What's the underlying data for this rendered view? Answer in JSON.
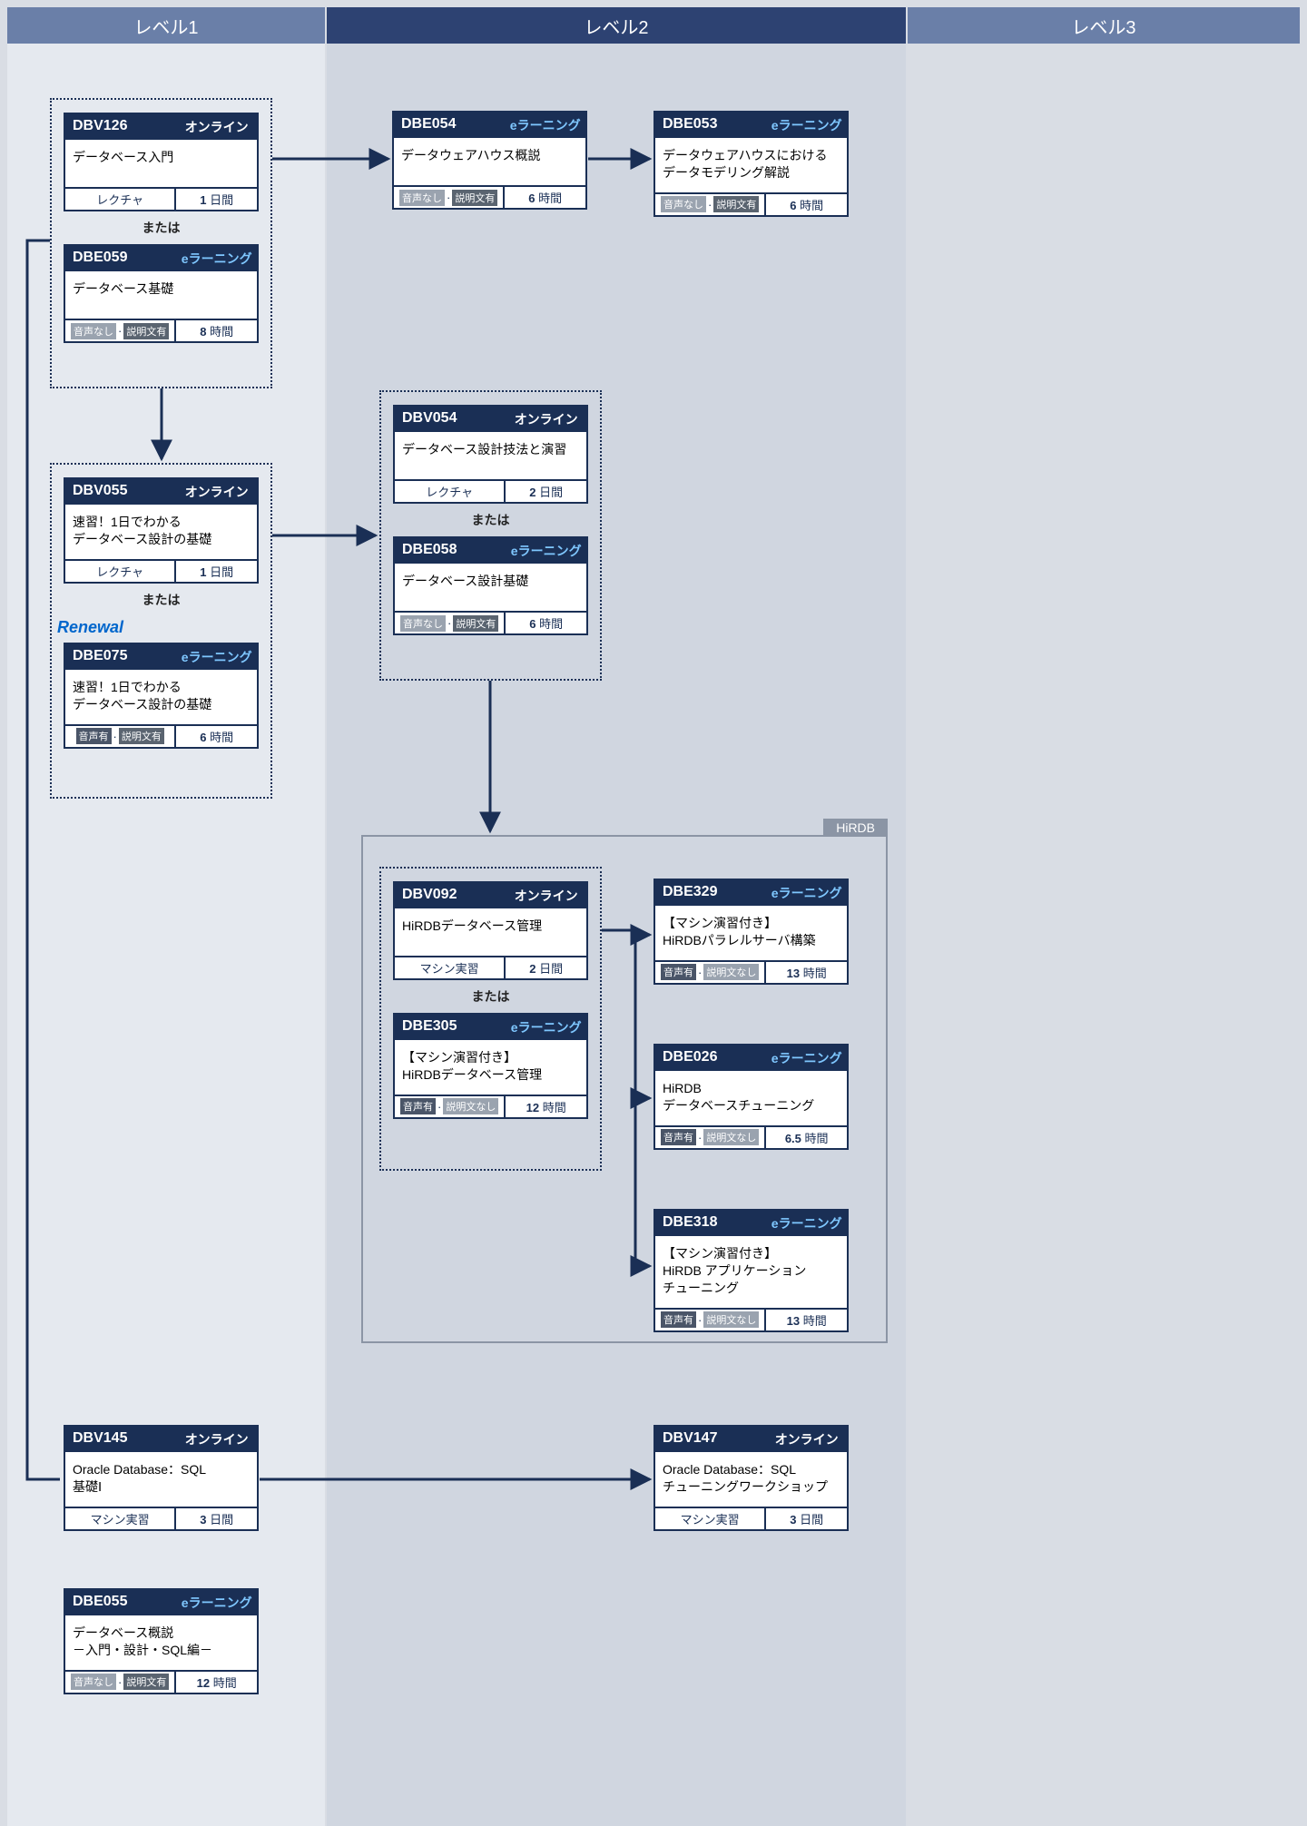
{
  "levels": {
    "l1": "レベル1",
    "l2": "レベル2",
    "l3": "レベル3"
  },
  "labels": {
    "or": "または",
    "renewal": "Renewal",
    "hirdb": "HiRDB"
  },
  "type": {
    "online": "オンライン",
    "elearning": "eラーニング"
  },
  "foot": {
    "lecture": "レクチャ",
    "machine": "マシン実習",
    "audio_no": "音声なし",
    "audio_yes": "音声有",
    "desc_yes": "説明文有",
    "desc_no": "説明文なし"
  },
  "units": {
    "day": "日間",
    "hour": "時間"
  },
  "cards": {
    "DBV126": {
      "code": "DBV126",
      "type": "online",
      "title": "データベース入門",
      "foot_mode": "lecture",
      "dur": "1",
      "unit": "day"
    },
    "DBE059": {
      "code": "DBE059",
      "type": "elearning",
      "title": "データベース基礎",
      "foot_mode": "audio_desc",
      "audio": "no",
      "desc": "yes",
      "dur": "8",
      "unit": "hour"
    },
    "DBV055": {
      "code": "DBV055",
      "type": "online",
      "title": "速習！1日でわかる\nデータベース設計の基礎",
      "foot_mode": "lecture",
      "dur": "1",
      "unit": "day"
    },
    "DBE075": {
      "code": "DBE075",
      "type": "elearning",
      "title": "速習！1日でわかる\nデータベース設計の基礎",
      "foot_mode": "audio_desc",
      "audio": "yes",
      "desc": "yes",
      "dur": "6",
      "unit": "hour"
    },
    "DBE054": {
      "code": "DBE054",
      "type": "elearning",
      "title": "データウェアハウス概説",
      "foot_mode": "audio_desc",
      "audio": "no",
      "desc": "yes",
      "dur": "6",
      "unit": "hour"
    },
    "DBE053": {
      "code": "DBE053",
      "type": "elearning",
      "title": "データウェアハウスにおける\nデータモデリング解説",
      "foot_mode": "audio_desc",
      "audio": "no",
      "desc": "yes",
      "dur": "6",
      "unit": "hour"
    },
    "DBV054": {
      "code": "DBV054",
      "type": "online",
      "title": "データベース設計技法と演習",
      "foot_mode": "lecture",
      "dur": "2",
      "unit": "day"
    },
    "DBE058": {
      "code": "DBE058",
      "type": "elearning",
      "title": "データベース設計基礎",
      "foot_mode": "audio_desc",
      "audio": "no",
      "desc": "yes",
      "dur": "6",
      "unit": "hour"
    },
    "DBV092": {
      "code": "DBV092",
      "type": "online",
      "title": "HiRDBデータベース管理",
      "foot_mode": "machine",
      "dur": "2",
      "unit": "day"
    },
    "DBE305": {
      "code": "DBE305",
      "type": "elearning",
      "title": "【マシン演習付き】\nHiRDBデータベース管理",
      "foot_mode": "audio_desc",
      "audio": "yes",
      "desc": "no",
      "dur": "12",
      "unit": "hour"
    },
    "DBE329": {
      "code": "DBE329",
      "type": "elearning",
      "title": "【マシン演習付き】\nHiRDBパラレルサーバ構築",
      "foot_mode": "audio_desc",
      "audio": "yes",
      "desc": "no",
      "dur": "13",
      "unit": "hour"
    },
    "DBE026": {
      "code": "DBE026",
      "type": "elearning",
      "title": "HiRDB\nデータベースチューニング",
      "foot_mode": "audio_desc",
      "audio": "yes",
      "desc": "no",
      "dur": "6.5",
      "unit": "hour"
    },
    "DBE318": {
      "code": "DBE318",
      "type": "elearning",
      "title": "【マシン演習付き】\nHiRDB アプリケーション\nチューニング",
      "foot_mode": "audio_desc",
      "audio": "yes",
      "desc": "no",
      "dur": "13",
      "unit": "hour"
    },
    "DBV145": {
      "code": "DBV145",
      "type": "online",
      "title": "Oracle Database：SQL\n基礎Ⅰ",
      "foot_mode": "machine",
      "dur": "3",
      "unit": "day"
    },
    "DBV147": {
      "code": "DBV147",
      "type": "online",
      "title": "Oracle Database：SQL\nチューニングワークショップ",
      "foot_mode": "machine",
      "dur": "3",
      "unit": "day"
    },
    "DBE055": {
      "code": "DBE055",
      "type": "elearning",
      "title": "データベース概説\n－入門・設計・SQL編－",
      "foot_mode": "audio_desc",
      "audio": "no",
      "desc": "yes",
      "dur": "12",
      "unit": "hour"
    }
  }
}
